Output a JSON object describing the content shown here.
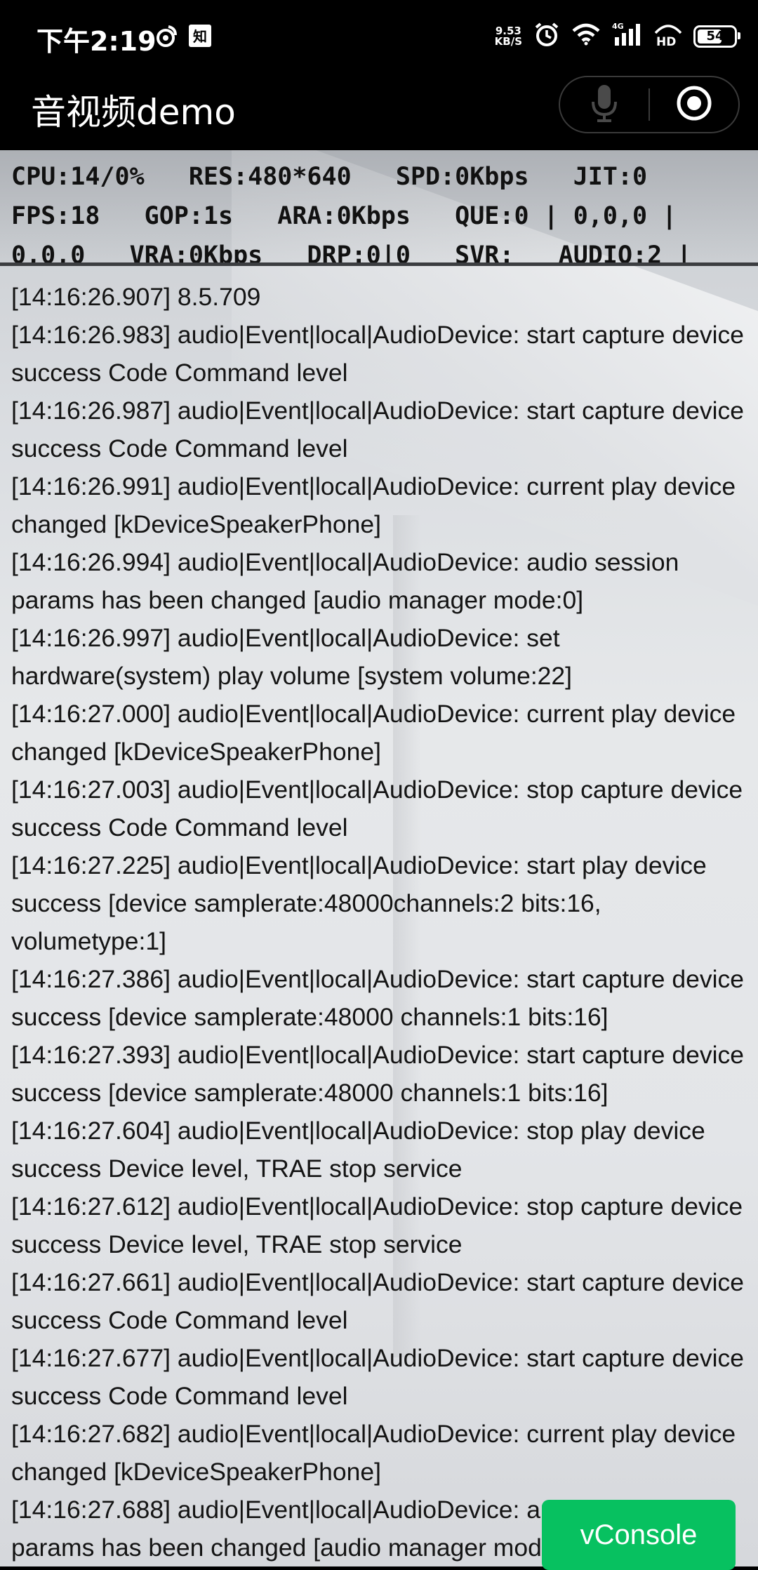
{
  "status_bar": {
    "time": "下午2:19",
    "net_speed_value": "9.53",
    "net_speed_unit": "KB/S",
    "network": "4G",
    "hd": "HD",
    "battery": "54"
  },
  "nav": {
    "title": "音视频demo"
  },
  "stats": {
    "line1": "CPU:14/0%   RES:480*640   SPD:0Kbps   JIT:0",
    "line2": "FPS:18   GOP:1s   ARA:0Kbps   QUE:0 | 0,0,0 |",
    "line3": "0,0,0   VRA:0Kbps   DRP:0|0   SVR:   AUDIO:2 |"
  },
  "log": [
    "[14:16:26.907] 8.5.709",
    "[14:16:26.983] audio|Event|local|AudioDevice: start capture device success Code Command level",
    "[14:16:26.987] audio|Event|local|AudioDevice: start capture device success Code Command level",
    "[14:16:26.991] audio|Event|local|AudioDevice: current play device changed [kDeviceSpeakerPhone]",
    "[14:16:26.994] audio|Event|local|AudioDevice: audio session params has been changed [audio manager mode:0]",
    "[14:16:26.997] audio|Event|local|AudioDevice: set hardware(system) play volume [system volume:22]",
    "[14:16:27.000] audio|Event|local|AudioDevice: current play device changed [kDeviceSpeakerPhone]",
    "[14:16:27.003] audio|Event|local|AudioDevice: stop capture device success Code Command level",
    "[14:16:27.225] audio|Event|local|AudioDevice: start play device success [device samplerate:48000channels:2 bits:16, volumetype:1]",
    "[14:16:27.386] audio|Event|local|AudioDevice: start capture device success [device samplerate:48000 channels:1 bits:16]",
    "[14:16:27.393] audio|Event|local|AudioDevice: start capture device success [device samplerate:48000 channels:1 bits:16]",
    "[14:16:27.604] audio|Event|local|AudioDevice: stop play device success Device level, TRAE stop service",
    "[14:16:27.612] audio|Event|local|AudioDevice: stop capture device success Device level, TRAE stop service",
    "[14:16:27.661] audio|Event|local|AudioDevice: start capture device success Code Command level",
    "[14:16:27.677] audio|Event|local|AudioDevice: start capture device success Code Command level",
    "[14:16:27.682] audio|Event|local|AudioDevice: current play device changed [kDeviceSpeakerPhone]",
    "[14:16:27.688] audio|Event|local|AudioDevice: audio session params has been changed [audio manager mode:0]"
  ],
  "vconsole_label": "vConsole",
  "colors": {
    "vconsole_green": "#07c160",
    "bar_background": "#000000",
    "log_text": "#141414"
  },
  "icons": [
    "weibo-icon",
    "zhihu-icon",
    "alarm-icon",
    "wifi-icon",
    "signal-icon",
    "battery-icon",
    "microphone-icon",
    "record-icon"
  ]
}
